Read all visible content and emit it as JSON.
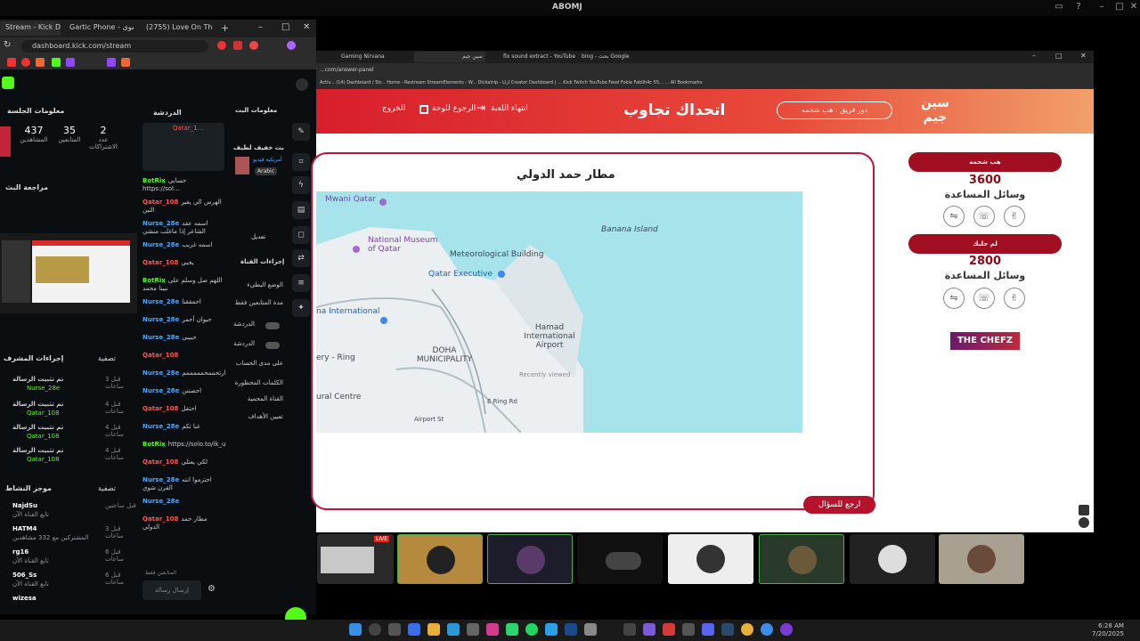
{
  "system": {
    "title": "ABOMJ"
  },
  "left_browser": {
    "tabs": [
      "Stream - Kick Dash",
      "Gartic Phone - تسوى",
      "(2755) Love On The..."
    ],
    "url": "dashboard.kick.com/stream",
    "session": {
      "header": "معلومات الجلسة",
      "viewers": "437",
      "viewers_label": "المشاهدين",
      "followers": "35",
      "followers_label": "المتابعين",
      "subs": "2",
      "subs_label": "عدد الاشتراكات"
    },
    "review": "مراجعة البث",
    "chat_header": "الدردشة",
    "stream_info": {
      "header": "معلومات البث",
      "title": "بث خفيف لطيف",
      "category": "أمريكية فيديو",
      "language": "Arabic",
      "edit": "تعديل"
    },
    "pinned_user": "Qatar_1...",
    "chat": [
      {
        "user": "BotRix",
        "text": "حسابي https://sol..."
      },
      {
        "user": "Qatar_108",
        "text": "الهرس الي يغير الثين"
      },
      {
        "user": "Nurse_28e",
        "text": "اسمه عقد الشاعر إذا ماغلب منشي"
      },
      {
        "user": "Nurse_28e",
        "text": "اسمه غريب"
      },
      {
        "user": "Qatar_108",
        "text": "يحبي"
      },
      {
        "user": "BotRix",
        "text": "اللهم صل وسلم على نبينا محمد"
      },
      {
        "user": "Nurse_28e",
        "text": "احمققنا"
      },
      {
        "user": "Nurse_28e",
        "text": "حيوان أحمر"
      },
      {
        "user": "Nurse_28e",
        "text": "حبيبي"
      },
      {
        "user": "Qatar_108",
        "text": ""
      },
      {
        "user": "Nurse_28e",
        "text": "ارتحممحمممممم"
      },
      {
        "user": "Nurse_28e",
        "text": "احصننن"
      },
      {
        "user": "Qatar_108",
        "text": "احتفل"
      },
      {
        "user": "Nurse_28e",
        "text": "غبا تكم"
      },
      {
        "user": "BotRix",
        "text": "https://solo.to/ik_ur"
      },
      {
        "user": "Qatar_108",
        "text": "لكي يعتلي"
      },
      {
        "user": "Nurse_28e",
        "text": "احتزموا انته القرن شوي"
      },
      {
        "user": "Nurse_28e",
        "text": ""
      },
      {
        "user": "Qatar_108",
        "text": "مطار حمد الدولي"
      }
    ],
    "chat_placeholder": "إرسال رسالة",
    "chat_footer": "المتابعين فقط",
    "mod_actions": {
      "header": "إجراءات المشرف",
      "filter": "تصفية",
      "rows": [
        {
          "title": "تم تثبيت الرسالة",
          "by": "Nurse_28e",
          "time": "قبل 3 ساعات"
        },
        {
          "title": "تم تثبيت الرسالة",
          "by": "Qatar_108",
          "time": "قبل 4 ساعات"
        },
        {
          "title": "تم تثبيت الرسالة",
          "by": "Qatar_108",
          "time": "قبل 4 ساعات"
        },
        {
          "title": "تم تثبيت الرسالة",
          "by": "Qatar_108",
          "time": "قبل 4 ساعات"
        }
      ]
    },
    "activity": {
      "header": "موجز النشاط",
      "filter": "تصفية",
      "rows": [
        {
          "user": "NajdSu",
          "text": "تابع القناة الآن",
          "time": "قبل ساعتين"
        },
        {
          "user": "HATM4",
          "text": "المشتركين مع 332 مشاهدين",
          "time": "قبل 3 ساعات"
        },
        {
          "user": "rg16",
          "text": "تابع القناة الآن",
          "time": "قبل 6 ساعات"
        },
        {
          "user": "506_Ss",
          "text": "تابع القناة الآن",
          "time": "قبل 6 ساعات"
        },
        {
          "user": "wizesa",
          "text": "",
          "time": ""
        }
      ]
    },
    "quick_actions": {
      "header": "إجراءات القناة",
      "items": [
        "الوضع البطيء",
        "مدة المتابعين فقط",
        "الدردشة",
        "الدردشة",
        "على مدى الحساب",
        "الكلمات المحظورة",
        "القناة المحمية",
        "تعيين الأهداف"
      ]
    }
  },
  "right_browser": {
    "tabs": [
      "Gaming Nirvana",
      "",
      "سين جيم",
      "fix sound extract - YouTube",
      "bing - بحث Google"
    ],
    "url": "...com/answer-panel",
    "bookmarks": "Activ... (14) Dashboard / Str... Home - Restream StreamElements - W... Dickatrip - ازايا Creator Dashboard | ... Kick Twitch YouTube Feed Fokia Fabllh4c 55... ... All Bookmarks",
    "game": {
      "title": "اتحداك تجاوب",
      "turn": "دور فريق : هب شحمه",
      "end_game": "انتهاء اللعبة",
      "back_board": "الرجوع للوحة",
      "exit": "الخروج",
      "logo": "سين جيم",
      "question": "مطار حمد الدولي",
      "back_to_question": "ارجع للسؤال",
      "lifelines_label": "وسائل المساعدة",
      "teams": [
        {
          "name": "هب شحمه",
          "score": "3600"
        },
        {
          "name": "لم حلبك",
          "score": "2800"
        }
      ],
      "sponsor": "THE CHEFZ",
      "map_labels": [
        "Mwani Qatar",
        "National Museum of Qatar",
        "Meteorological Building",
        "Banana Island",
        "Qatar Executive",
        "Hamad International Airport",
        "Recently viewed",
        "DOHA MUNICIPALITY",
        "na International",
        "ery - Ring",
        "ural Centre",
        "E Ring Rd",
        "Airport St"
      ]
    }
  },
  "webcams": [
    {
      "label": "LIVE"
    },
    {
      "label": ""
    },
    {
      "label": ""
    },
    {
      "label": ""
    },
    {
      "label": ""
    },
    {
      "label": ""
    },
    {
      "label": ""
    },
    {
      "label": ""
    }
  ],
  "taskbar": {
    "time": "6:28 AM",
    "date": "7/20/2025"
  }
}
